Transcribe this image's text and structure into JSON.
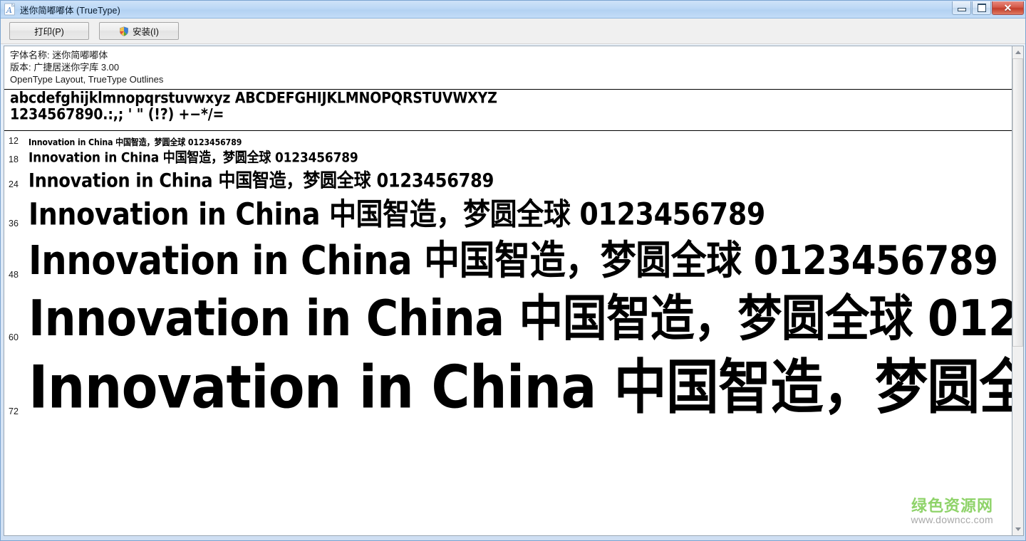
{
  "window": {
    "title": "迷你简嘟嘟体 (TrueType)",
    "icon": "font-file-icon",
    "caption": {
      "minimize": "–",
      "maximize": "□",
      "close": "✕"
    }
  },
  "toolbar": {
    "print_label": "打印(P)",
    "install_label": "安装(I)",
    "install_icon": "uac-shield-icon"
  },
  "info": {
    "name_line": "字体名称: 迷你简嘟嘟体",
    "version_line": "版本: 广捷居迷你字库 3.00",
    "outline_line": "OpenType Layout, TrueType Outlines"
  },
  "alphabet": {
    "lowercase_uppercase": "abcdefghijklmnopqrstuvwxyz ABCDEFGHIJKLMNOPQRSTUVWXYZ",
    "digits_punctuation": "1234567890.:,; ' \" (!?) +−*/="
  },
  "sample": {
    "text": "Innovation in China 中国智造，梦圆全球 0123456789",
    "rows": [
      {
        "size": "12"
      },
      {
        "size": "18"
      },
      {
        "size": "24"
      },
      {
        "size": "36"
      },
      {
        "size": "48"
      },
      {
        "size": "60"
      },
      {
        "size": "72"
      }
    ]
  },
  "scrollbar": {
    "up_arrow": "scroll-up-arrow-icon",
    "down_arrow": "scroll-down-arrow-icon"
  },
  "watermark": {
    "site_name": "绿色资源网",
    "site_url": "www.downcc.com"
  },
  "colors": {
    "titlebar": "#b3d2f2",
    "close_button": "#c23e2b",
    "watermark_green": "#8fd36a",
    "text": "#1a1a1a"
  }
}
